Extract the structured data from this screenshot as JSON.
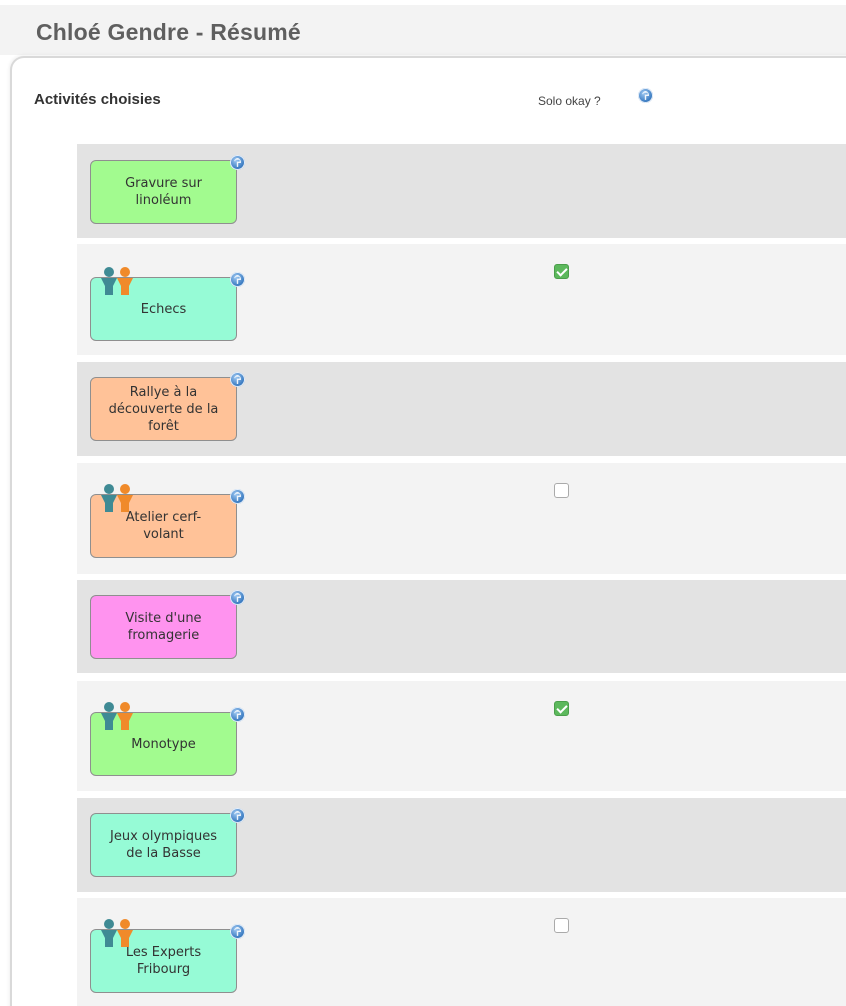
{
  "page": {
    "title": "Chloé Gendre - Résumé"
  },
  "section": {
    "title": "Activités choisies",
    "solo_label": "Solo okay ?"
  },
  "activities": [
    {
      "lines": [
        "Gravure sur",
        "linoléum"
      ],
      "color": "#a2fb8f",
      "group": false,
      "solo_okay": null
    },
    {
      "lines": [
        "Echecs"
      ],
      "color": "#96fbd6",
      "group": true,
      "solo_okay": true
    },
    {
      "lines": [
        "Rallye à la",
        "découverte de la",
        "forêt"
      ],
      "color": "#ffc298",
      "group": false,
      "solo_okay": null
    },
    {
      "lines": [
        "Atelier cerf-",
        "volant"
      ],
      "color": "#ffc298",
      "group": true,
      "solo_okay": false
    },
    {
      "lines": [
        "Visite d'une",
        "fromagerie"
      ],
      "color": "#ff93ef",
      "group": false,
      "solo_okay": null
    },
    {
      "lines": [
        "Monotype"
      ],
      "color": "#a2fb8f",
      "group": true,
      "solo_okay": true
    },
    {
      "lines": [
        "Jeux olympiques",
        "de la Basse"
      ],
      "color": "#96fbd6",
      "group": false,
      "solo_okay": null
    },
    {
      "lines": [
        "Les Experts",
        "Fribourg"
      ],
      "color": "#96fbd6",
      "group": true,
      "solo_okay": false
    }
  ],
  "icons": {
    "help": "help-icon",
    "group": "group-people-icon",
    "checkbox_checked": "checkbox-checked-icon",
    "checkbox_unchecked": "checkbox-unchecked-icon"
  }
}
